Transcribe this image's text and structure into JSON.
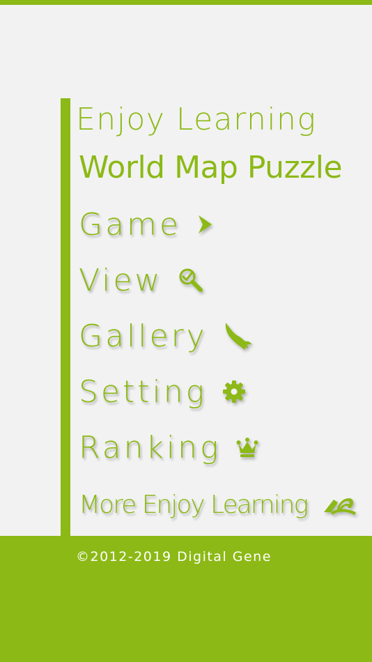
{
  "title_line1": "Enjoy Learning",
  "title_line2": "World Map Puzzle",
  "menu": [
    {
      "label": "Game",
      "icon": "play-arrow-icon"
    },
    {
      "label": "View",
      "icon": "magnifier-check-icon"
    },
    {
      "label": "Gallery",
      "icon": "bird-icon"
    },
    {
      "label": "Setting",
      "icon": "gear-icon"
    },
    {
      "label": "Ranking",
      "icon": "crown-icon"
    },
    {
      "label": "More Enjoy Learning",
      "icon": "enjoy-learning-logo-icon"
    }
  ],
  "footer": {
    "copyright": "©2012-2019 Digital Gene"
  },
  "colors": {
    "accent": "#8cb916",
    "background": "#f2f2f2",
    "footer_text": "#ffffff"
  }
}
